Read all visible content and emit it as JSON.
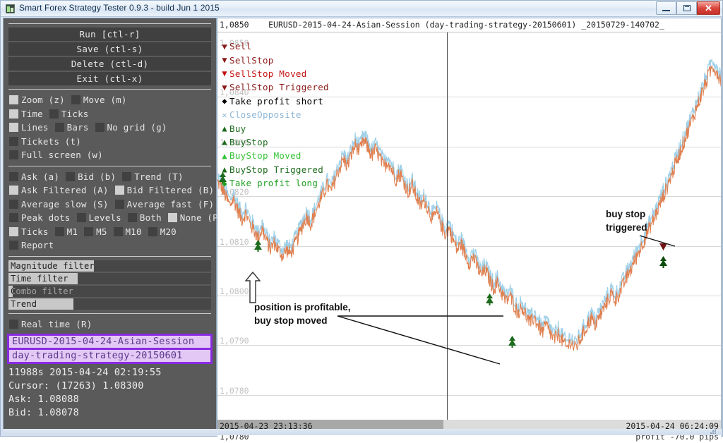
{
  "window": {
    "title": "Smart Forex Strategy Tester 0.9.3 - build Jun  1 2015",
    "minimize_label": "–",
    "maximize_label": "□",
    "close_label": "✕"
  },
  "sidebar": {
    "buttons": [
      {
        "label": "Run  [ctl-r]",
        "name": "run-button"
      },
      {
        "label": "Save  (ctl-s)",
        "name": "save-button"
      },
      {
        "label": "Delete  (ctl-d)",
        "name": "delete-button"
      },
      {
        "label": "Exit  (ctl-x)",
        "name": "exit-button"
      }
    ],
    "checkbox_rows": [
      {
        "items": [
          {
            "label": "Zoom  (z)",
            "checked": true,
            "name": "checkbox-zoom"
          },
          {
            "label": "Move  (m)",
            "checked": false,
            "name": "checkbox-move"
          }
        ]
      },
      {
        "items": [
          {
            "label": "Time",
            "checked": true,
            "name": "checkbox-time"
          },
          {
            "label": "Ticks",
            "checked": false,
            "name": "checkbox-ticks-mode"
          }
        ]
      },
      {
        "items": [
          {
            "label": "Lines",
            "checked": true,
            "name": "checkbox-lines"
          },
          {
            "label": "Bars",
            "checked": false,
            "name": "checkbox-bars"
          },
          {
            "label": "No  grid  (g)",
            "checked": false,
            "name": "checkbox-no-grid"
          }
        ]
      },
      {
        "items": [
          {
            "label": "Tickets  (t)",
            "checked": false,
            "name": "checkbox-tickets"
          }
        ]
      },
      {
        "items": [
          {
            "label": "Full  screen  (w)",
            "checked": false,
            "name": "checkbox-full-screen"
          }
        ]
      }
    ],
    "checkbox_rows2": [
      {
        "items": [
          {
            "label": "Ask  (a)",
            "checked": false,
            "name": "checkbox-ask"
          },
          {
            "label": "Bid  (b)",
            "checked": false,
            "name": "checkbox-bid"
          },
          {
            "label": "Trend  (T)",
            "checked": false,
            "name": "checkbox-trend"
          }
        ]
      },
      {
        "items": [
          {
            "label": "Ask  Filtered  (A)",
            "checked": true,
            "name": "checkbox-ask-filtered"
          },
          {
            "label": "Bid  Filtered  (B)",
            "checked": true,
            "name": "checkbox-bid-filtered"
          }
        ]
      },
      {
        "items": [
          {
            "label": "Average  slow  (S)",
            "checked": false,
            "name": "checkbox-average-slow"
          },
          {
            "label": "Average  fast  (F)",
            "checked": false,
            "name": "checkbox-average-fast"
          }
        ]
      },
      {
        "items": [
          {
            "label": "Peak  dots",
            "checked": false,
            "name": "checkbox-peak-dots"
          },
          {
            "label": "Levels",
            "checked": false,
            "name": "checkbox-levels"
          },
          {
            "label": "Both",
            "checked": false,
            "name": "checkbox-both"
          },
          {
            "label": "None  (P)",
            "checked": true,
            "name": "checkbox-none"
          }
        ]
      },
      {
        "items": [
          {
            "label": "Ticks",
            "checked": true,
            "name": "checkbox-ticks-tf"
          },
          {
            "label": "M1",
            "checked": false,
            "name": "checkbox-m1"
          },
          {
            "label": "M5",
            "checked": false,
            "name": "checkbox-m5"
          },
          {
            "label": "M10",
            "checked": false,
            "name": "checkbox-m10"
          },
          {
            "label": "M20",
            "checked": false,
            "name": "checkbox-m20"
          }
        ]
      },
      {
        "items": [
          {
            "label": "Report",
            "checked": false,
            "name": "checkbox-report"
          }
        ]
      }
    ],
    "filters": [
      {
        "label": "Magnitude  filter",
        "fill_pct": 42,
        "name": "slider-magnitude-filter"
      },
      {
        "label": "Time  filter",
        "fill_pct": 34,
        "name": "slider-time-filter"
      },
      {
        "label": "Combo  filter",
        "fill_pct": 2,
        "name": "slider-combo-filter"
      },
      {
        "label": "Trend",
        "fill_pct": 32,
        "name": "slider-trend-filter"
      }
    ],
    "realtime": {
      "label": "Real  time  (R)",
      "checked": false
    },
    "session_lines": [
      "EURUSD-2015-04-24-Asian-Session",
      "day-trading-strategy-20150601"
    ],
    "status": [
      "11988s 2015-04-24 02:19:55",
      "Cursor: (17263) 1.08300",
      "Ask: 1.08088",
      "Bid: 1.08078"
    ]
  },
  "chart": {
    "top_left_price": "1,0850",
    "title": "EURUSD-2015-04-24-Asian-Session (day-trading-strategy-20150601) _20150729-140702_",
    "legend": [
      {
        "glyph": "▼",
        "color": "#8b1a1a",
        "label": "Sell",
        "name": "legend-sell"
      },
      {
        "glyph": "▼",
        "color": "#8b1a1a",
        "label": "SellStop",
        "name": "legend-sellstop"
      },
      {
        "glyph": "▼",
        "color": "#c41212",
        "label": "SellStop Moved",
        "name": "legend-sellstop-moved"
      },
      {
        "glyph": "▼",
        "color": "#8b1a1a",
        "label": "SellStop Triggered",
        "name": "legend-sellstop-triggered"
      },
      {
        "glyph": "◆",
        "color": "#000000",
        "label": "Take profit short",
        "name": "legend-take-profit-short"
      },
      {
        "glyph": "✕",
        "color": "#8fb8d8",
        "label": "CloseOpposite",
        "name": "legend-close-opposite"
      },
      {
        "glyph": "▲",
        "color": "#1d6b1d",
        "label": "Buy",
        "name": "legend-buy"
      },
      {
        "glyph": "▲",
        "color": "#1d6b1d",
        "label": "BuyStop",
        "name": "legend-buystop"
      },
      {
        "glyph": "▲",
        "color": "#35c335",
        "label": "BuyStop Moved",
        "name": "legend-buystop-moved"
      },
      {
        "glyph": "▲",
        "color": "#1d6b1d",
        "label": "BuyStop Triggered",
        "name": "legend-buystop-triggered"
      },
      {
        "glyph": "◆",
        "color": "#22a022",
        "label": "Take profit long",
        "name": "legend-take-profit-long"
      }
    ],
    "annotations": [
      {
        "text": "position is profitable,\nbuy stop moved",
        "name": "annotation-buy-stop-moved"
      },
      {
        "text": "buy stop\ntriggered",
        "name": "annotation-buy-stop-triggered"
      }
    ],
    "scroll_left_label": "2015-04-23 23:13:36",
    "scroll_right_label": "2015-04-24 06:24:09",
    "foot_left_label": "1,0780",
    "foot_right_label": "profit -70.0 pips"
  },
  "chart_data": {
    "type": "line",
    "title": "EURUSD-2015-04-24-Asian-Session (day-trading-strategy-20150601) _20150729-140702_",
    "xlabel": "",
    "ylabel": "",
    "ylim": [
      1.0775,
      1.0853
    ],
    "grid": true,
    "y_ticks": [
      "1,0850",
      "1,0840",
      "1,0830",
      "1,0820",
      "1,0810",
      "1,0800",
      "1,0790",
      "1,0780"
    ],
    "y_tick_values": [
      1.085,
      1.084,
      1.083,
      1.082,
      1.081,
      1.08,
      1.079,
      1.078
    ],
    "x_range": [
      "2015-04-23 23:13:36",
      "2015-04-24 06:24:09"
    ],
    "series": [
      {
        "name": "Ask Filtered",
        "color": "#9fd0e8"
      },
      {
        "name": "Bid Filtered",
        "color": "#e08050"
      }
    ],
    "ask_values": [
      1.08235,
      1.08225,
      1.08205,
      1.08188,
      1.082,
      1.08178,
      1.0816,
      1.08172,
      1.0815,
      1.08138,
      1.08122,
      1.0814,
      1.08118,
      1.081,
      1.08112,
      1.08098,
      1.08086,
      1.08098,
      1.0809,
      1.08108,
      1.08126,
      1.08148,
      1.08165,
      1.0815,
      1.0817,
      1.08192,
      1.0821,
      1.08228,
      1.08215,
      1.0824,
      1.08262,
      1.0828,
      1.08268,
      1.0829,
      1.0831,
      1.08296,
      1.08318,
      1.08305,
      1.08288,
      1.083,
      1.08282,
      1.08265,
      1.08278,
      1.08258,
      1.0824,
      1.08252,
      1.08232,
      1.08215,
      1.08228,
      1.08205,
      1.08186,
      1.08198,
      1.08178,
      1.0816,
      1.08172,
      1.0815,
      1.0813,
      1.08142,
      1.0812,
      1.08098,
      1.0811,
      1.0809,
      1.08072,
      1.08084,
      1.08064,
      1.08046,
      1.08058,
      1.08038,
      1.0802,
      1.08032,
      1.08012,
      1.07994,
      1.08006,
      1.07988,
      1.07972,
      1.07984,
      1.07966,
      1.0795,
      1.07962,
      1.07946,
      1.07932,
      1.07946,
      1.0793,
      1.07916,
      1.0793,
      1.07914,
      1.079,
      1.07914,
      1.07898,
      1.07912,
      1.07928,
      1.07944,
      1.0796,
      1.07946,
      1.07962,
      1.07978,
      1.07994,
      1.0801,
      1.07996,
      1.08012,
      1.08028,
      1.08046,
      1.08062,
      1.0808,
      1.08098,
      1.08116,
      1.08134,
      1.08152,
      1.0817,
      1.0819,
      1.0821,
      1.0823,
      1.08252,
      1.08274,
      1.08296,
      1.08318,
      1.0834,
      1.08362,
      1.08384,
      1.08406,
      1.08428,
      1.0845,
      1.0847,
      1.08456,
      1.0844
    ],
    "markers": [
      {
        "type": "BuyStop Moved",
        "x_pct": 1.0,
        "price": 1.08235,
        "name": "marker-buystop-moved-1"
      },
      {
        "type": "BuyStop Moved",
        "x_pct": 8.0,
        "price": 1.08098,
        "name": "marker-buystop-moved-2"
      },
      {
        "type": "BuyStop Moved",
        "x_pct": 54.0,
        "price": 1.0799,
        "name": "marker-buystop-moved-3"
      },
      {
        "type": "BuyStop Moved",
        "x_pct": 58.5,
        "price": 1.07905,
        "name": "marker-buystop-moved-4"
      },
      {
        "type": "BuyStop Triggered",
        "x_pct": 88.5,
        "price": 1.08065,
        "name": "marker-buystop-triggered"
      }
    ]
  }
}
